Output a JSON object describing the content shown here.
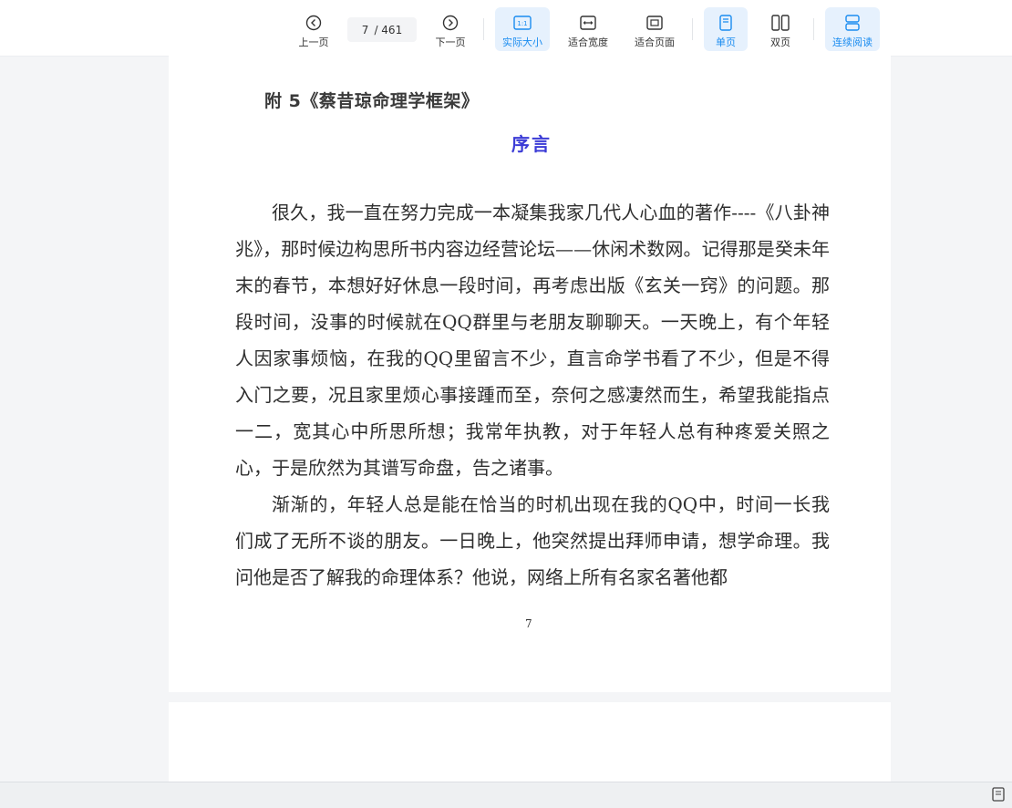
{
  "toolbar": {
    "prev_label": "上一页",
    "next_label": "下一页",
    "current_page": "7",
    "total_pages": "/ 461",
    "actual_size_label": "实际大小",
    "fit_width_label": "适合宽度",
    "fit_page_label": "适合页面",
    "single_page_label": "单页",
    "double_page_label": "双页",
    "continuous_label": "连续阅读",
    "actual_size_glyph": "1:1",
    "accent_color": "#1a8cf0"
  },
  "document": {
    "appendix_title": "附 5《蔡昔琼命理学框架》",
    "preface_title": "序言",
    "paragraphs": [
      "很久，我一直在努力完成一本凝集我家几代人心血的著作----《八卦神兆》，那时候边构思所书内容边经营论坛——休闲术数网。记得那是癸未年末的春节，本想好好休息一段时间，再考虑出版《玄关一窍》的问题。那段时间，没事的时候就在QQ群里与老朋友聊聊天。一天晚上，有个年轻人因家事烦恼，在我的QQ里留言不少，直言命学书看了不少，但是不得入门之要，况且家里烦心事接踵而至，奈何之感凄然而生，希望我能指点一二，宽其心中所思所想；我常年执教，对于年轻人总有种疼爱关照之心，于是欣然为其谱写命盘，告之诸事。",
      "渐渐的，年轻人总是能在恰当的时机出现在我的QQ中，时间一长我们成了无所不谈的朋友。一日晚上，他突然提出拜师申请，想学命理。我问他是否了解我的命理体系？他说，网络上所有名家名著他都"
    ],
    "page_number": "7"
  }
}
